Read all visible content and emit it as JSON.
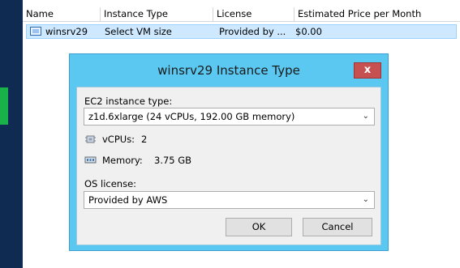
{
  "grid": {
    "columns": [
      "Name",
      "Instance Type",
      "License",
      "Estimated Price per Month"
    ],
    "rows": [
      {
        "name": "winsrv29",
        "instance_type": "Select VM size",
        "license": "Provided by ...",
        "price": "$0.00"
      }
    ]
  },
  "dialog": {
    "title": "winsrv29 Instance Type",
    "close_label": "x",
    "instance_type_label": "EC2 instance type:",
    "instance_type_value": "z1d.6xlarge (24 vCPUs, 192.00 GB memory)",
    "vcpus_label": "vCPUs:",
    "vcpus_value": "2",
    "memory_label": "Memory:",
    "memory_value": "3.75 GB",
    "os_license_label": "OS license:",
    "os_license_value": "Provided by AWS",
    "ok_label": "OK",
    "cancel_label": "Cancel"
  },
  "colors": {
    "background": "#0f2b52",
    "dialog_frame": "#5ac8f0",
    "close_button": "#c75050",
    "selection": "#cde8ff",
    "accent_green": "#19b14a"
  },
  "icons": [
    "vm-icon",
    "cpu-icon",
    "memory-icon",
    "chevron-down-icon",
    "close-icon"
  ]
}
